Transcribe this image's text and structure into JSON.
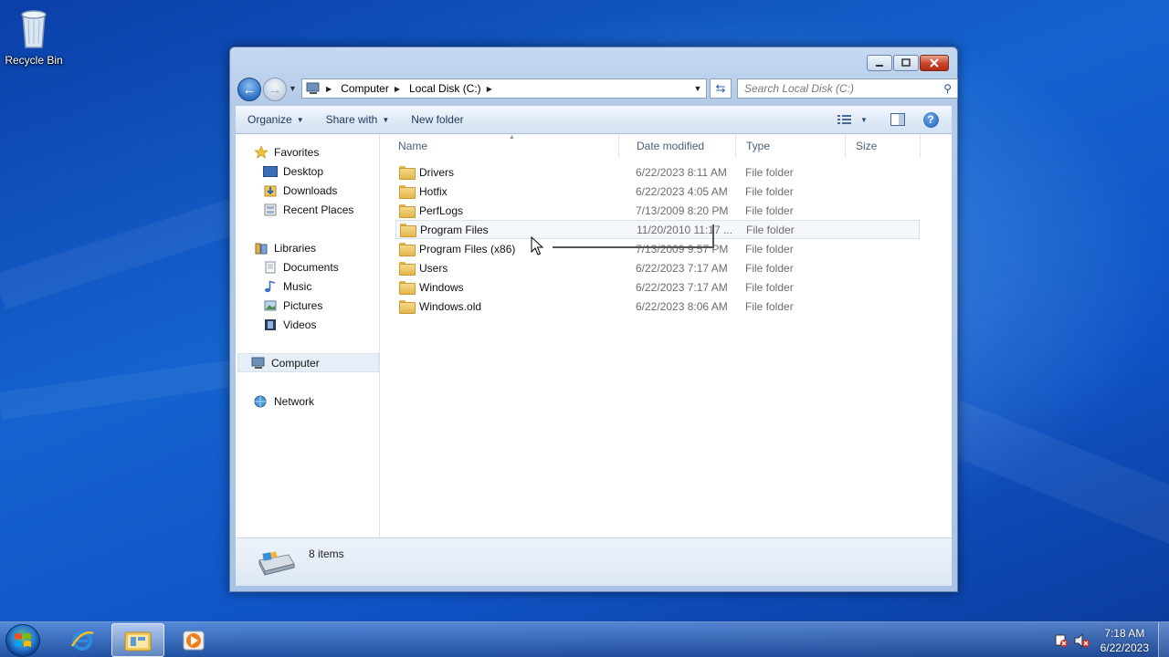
{
  "desktop": {
    "icons": [
      {
        "label": "Recycle Bin",
        "icon": "recycle-bin-icon"
      }
    ]
  },
  "window": {
    "controls": {
      "minimize": "minimize",
      "maximize": "maximize",
      "close": "close"
    },
    "address": {
      "segments": [
        "Computer",
        "Local Disk (C:)"
      ],
      "icon": "computer-icon"
    },
    "search": {
      "placeholder": "Search Local Disk (C:)"
    },
    "toolbar": {
      "organize": "Organize",
      "share_with": "Share with",
      "new_folder": "New folder"
    },
    "sidebar": {
      "favorites": {
        "label": "Favorites",
        "items": [
          "Desktop",
          "Downloads",
          "Recent Places"
        ]
      },
      "libraries": {
        "label": "Libraries",
        "items": [
          "Documents",
          "Music",
          "Pictures",
          "Videos"
        ]
      },
      "computer": "Computer",
      "network": "Network"
    },
    "columns": [
      "Name",
      "Date modified",
      "Type",
      "Size"
    ],
    "files": [
      {
        "name": "Drivers",
        "date": "6/22/2023 8:11 AM",
        "type": "File folder"
      },
      {
        "name": "Hotfix",
        "date": "6/22/2023 4:05 AM",
        "type": "File folder"
      },
      {
        "name": "PerfLogs",
        "date": "7/13/2009 8:20 PM",
        "type": "File folder"
      },
      {
        "name": "Program Files",
        "date": "11/20/2010 11:17 ...",
        "type": "File folder"
      },
      {
        "name": "Program Files (x86)",
        "date": "7/13/2009 9:57 PM",
        "type": "File folder"
      },
      {
        "name": "Users",
        "date": "6/22/2023 7:17 AM",
        "type": "File folder"
      },
      {
        "name": "Windows",
        "date": "6/22/2023 7:17 AM",
        "type": "File folder"
      },
      {
        "name": "Windows.old",
        "date": "6/22/2023 8:06 AM",
        "type": "File folder"
      }
    ],
    "status": {
      "count": "8 items"
    }
  },
  "taskbar": {
    "clock_time": "7:18 AM",
    "clock_date": "6/22/2023",
    "pinned": [
      "internet-explorer-icon",
      "windows-explorer-icon",
      "media-player-icon"
    ]
  }
}
